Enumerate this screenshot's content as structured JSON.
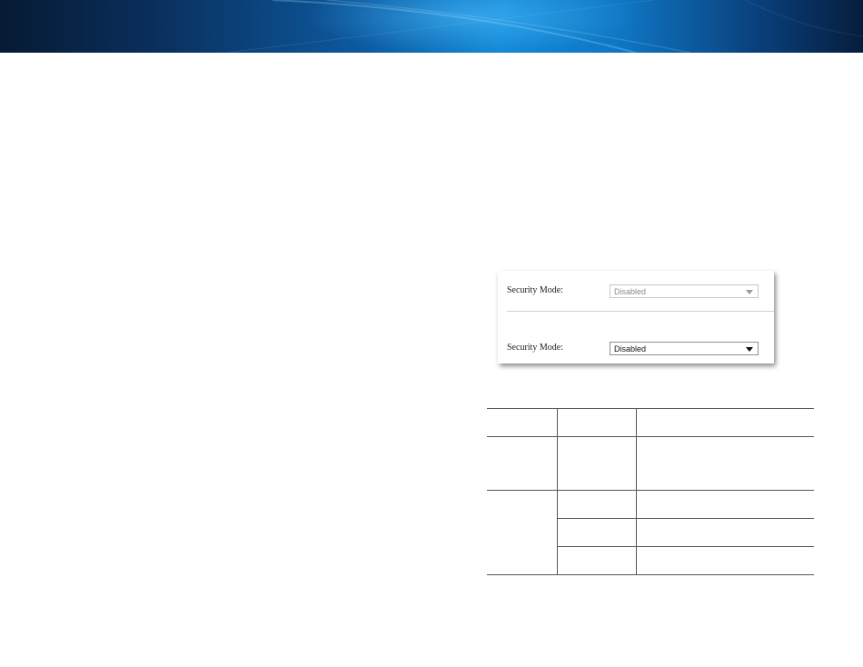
{
  "settings_screenshot": {
    "rows": [
      {
        "label": "Security Mode:",
        "value": "Disabled",
        "state": "inactive"
      },
      {
        "label": "Security Mode:",
        "value": "Disabled",
        "state": "active"
      }
    ]
  },
  "table": {
    "header": [
      "",
      "",
      ""
    ],
    "rows": [
      [
        "",
        "",
        ""
      ],
      [
        "",
        "",
        ""
      ],
      [
        "",
        "",
        ""
      ],
      [
        "",
        "",
        ""
      ]
    ]
  },
  "colors": {
    "banner_dark": "#061a33",
    "banner_light": "#1188d6"
  }
}
